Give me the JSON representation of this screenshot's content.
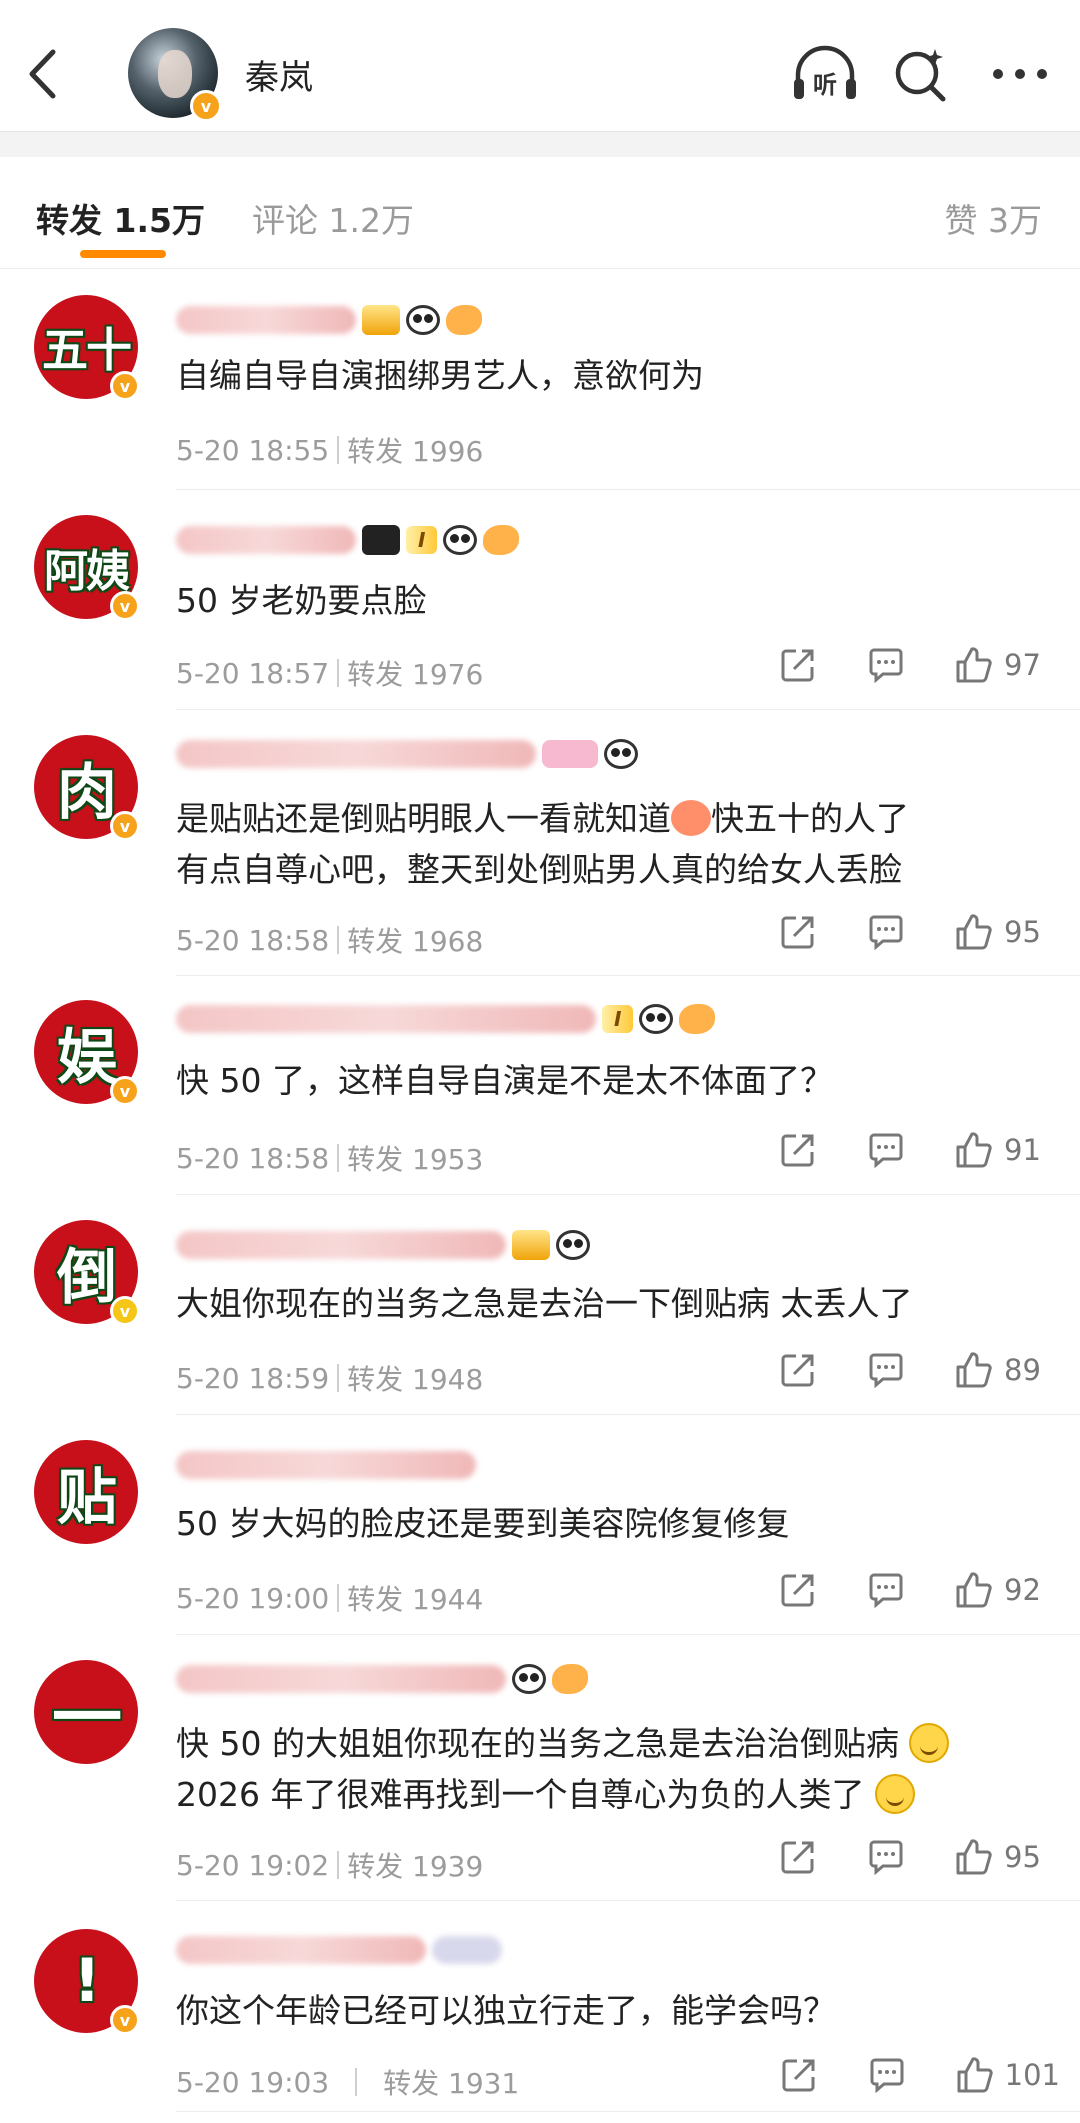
{
  "header": {
    "name": "秦岚",
    "listen_label": "听"
  },
  "tabs": [
    {
      "label": "转发 1.5万"
    },
    {
      "label": "评论 1.2万"
    },
    {
      "label": "赞 3万"
    }
  ],
  "comments": [
    {
      "avatar_text": "五十",
      "text": "自编自导自演捆绑男艺人，意欲何为",
      "time": "5-20 18:55",
      "repost": "转发 1996",
      "likes": ""
    },
    {
      "avatar_text": "阿姨",
      "text": "50 岁老奶要点脸",
      "time": "5-20 18:57",
      "repost": "转发 1976",
      "likes": "97"
    },
    {
      "avatar_text": "肉",
      "text_a": "是贴贴还是倒贴明眼人一看就知道",
      "text_b": "快五十的人了",
      "text_c": "有点自尊心吧，整天到处倒贴男人真的给女人丢脸",
      "time": "5-20 18:58",
      "repost": "转发 1968",
      "likes": "95"
    },
    {
      "avatar_text": "娱",
      "text": "快 50 了，这样自导自演是不是太不体面了？",
      "time": "5-20 18:58",
      "repost": "转发 1953",
      "likes": "91"
    },
    {
      "avatar_text": "倒",
      "text": "大姐你现在的当务之急是去治一下倒贴病 太丢人了",
      "time": "5-20 18:59",
      "repost": "转发 1948",
      "likes": "89"
    },
    {
      "avatar_text": "贴",
      "text": "50 岁大妈的脸皮还是要到美容院修复修复",
      "time": "5-20 19:00",
      "repost": "转发 1944",
      "likes": "92"
    },
    {
      "avatar_text": "一",
      "text_a": "快 50 的大姐姐你现在的当务之急是去治治倒贴病",
      "text_b": "2026 年了很难再找到一个自尊心为负的人类了",
      "time": "5-20 19:02",
      "repost": "转发 1939",
      "likes": "95"
    },
    {
      "avatar_text": "!",
      "text": "你这个年龄已经可以独立行走了，能学会吗？",
      "time": "5-20 19:03",
      "repost": "转发 1931",
      "likes": "101"
    }
  ]
}
